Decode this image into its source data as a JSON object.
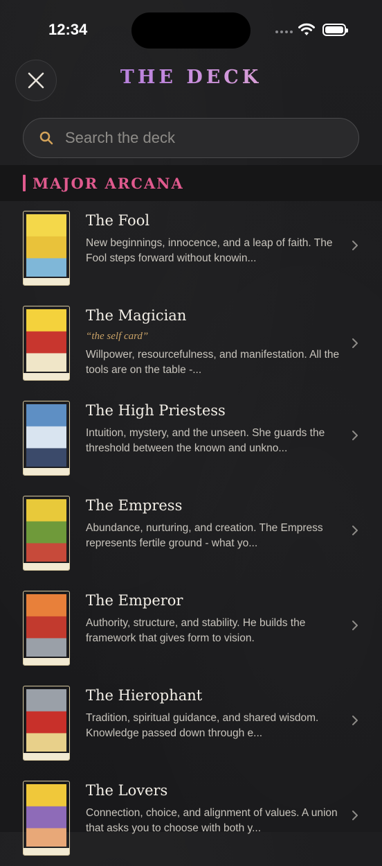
{
  "status": {
    "time": "12:34"
  },
  "header": {
    "title": "THE DECK",
    "close_label": "Close"
  },
  "search": {
    "placeholder": "Search the deck",
    "value": ""
  },
  "section": {
    "title": "MAJOR ARCANA"
  },
  "cards": [
    {
      "name": "The Fool",
      "tagline": "",
      "desc": "New beginnings, innocence, and a leap of faith. The Fool steps forward without knowin...",
      "colors": [
        "#f4d84a",
        "#e9c23a",
        "#7fb7d8"
      ]
    },
    {
      "name": "The Magician",
      "tagline": "“the self card”",
      "desc": "Willpower, resourcefulness, and manifestation. All the tools are on the table -...",
      "colors": [
        "#f4d23c",
        "#c8362e",
        "#f0e6c8"
      ]
    },
    {
      "name": "The High Priestess",
      "tagline": "",
      "desc": "Intuition, mystery, and the unseen. She guards the threshold between the known and unkno...",
      "colors": [
        "#5e8fc4",
        "#d9e4f0",
        "#3b4a6a"
      ]
    },
    {
      "name": "The Empress",
      "tagline": "",
      "desc": "Abundance, nurturing, and creation. The Empress represents fertile ground - what yo...",
      "colors": [
        "#e8c93a",
        "#6f9a3a",
        "#c74a3a"
      ]
    },
    {
      "name": "The Emperor",
      "tagline": "",
      "desc": "Authority, structure, and stability. He builds the framework that gives form to vision.",
      "colors": [
        "#e8803a",
        "#c23a2e",
        "#9aa0a8"
      ]
    },
    {
      "name": "The Hierophant",
      "tagline": "",
      "desc": "Tradition, spiritual guidance, and shared wisdom. Knowledge passed down through e...",
      "colors": [
        "#9aa0a8",
        "#c8302a",
        "#e8d08a"
      ]
    },
    {
      "name": "The Lovers",
      "tagline": "",
      "desc": "Connection, choice, and alignment of values. A union that asks you to choose with both y...",
      "colors": [
        "#f0c83a",
        "#8e6bb8",
        "#e8a878"
      ]
    }
  ]
}
